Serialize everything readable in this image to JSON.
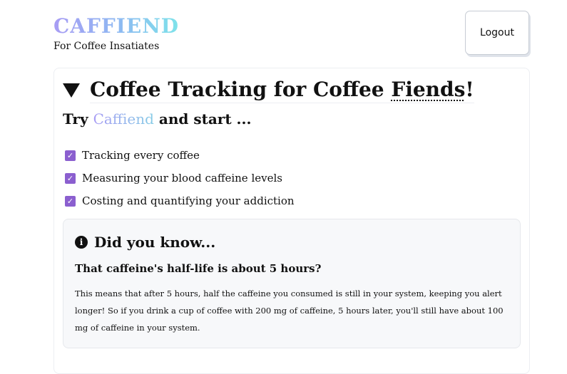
{
  "header": {
    "brand": "CAFFIEND",
    "tagline": "For Coffee Insatiates",
    "logout_label": "Logout"
  },
  "main": {
    "title_prefix": "Coffee Tracking for Coffee ",
    "title_emphasis": "Fiends",
    "title_suffix": "!",
    "try_prefix": "Try ",
    "try_brand": "Caffiend",
    "try_suffix": " and start ...",
    "features": [
      "Tracking every coffee",
      "Measuring your blood caffeine levels",
      "Costing and quantifying your addiction"
    ]
  },
  "info": {
    "icon": "info-icon",
    "title": "Did you know...",
    "subtitle": "That caffeine's half-life is about 5 hours?",
    "body": "This means that after 5 hours, half the caffeine you consumed is still in your system, keeping you alert longer! So if you drink a cup of coffee with 200 mg of caffeine, 5 hours later, you'll still have about 100 mg of caffeine in your system."
  },
  "colors": {
    "brand_gradient_start": "#a89cf4",
    "brand_gradient_end": "#7ee3ea",
    "checkbox": "#8b5fcf"
  }
}
